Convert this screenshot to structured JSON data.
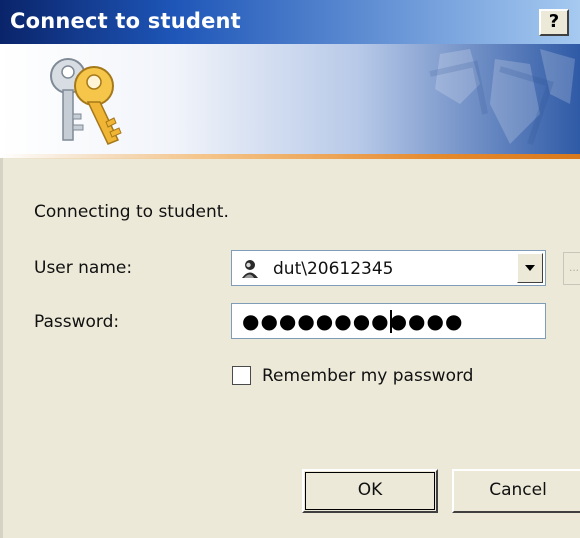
{
  "window": {
    "title": "Connect to student",
    "help_label": "?"
  },
  "banner": {
    "icon": "keys-icon"
  },
  "message": "Connecting to student.",
  "user_name": {
    "label": "User name:",
    "value": "dut\\20612345",
    "icon": "user-account-icon"
  },
  "password": {
    "label": "Password:",
    "masked_value": "●●●●●●●●●●●●"
  },
  "remember": {
    "label": "Remember my password",
    "checked": false
  },
  "buttons": {
    "ok": "OK",
    "cancel": "Cancel",
    "browse": "..."
  },
  "colors": {
    "titlebar_start": "#0a246a",
    "titlebar_end": "#a6caf0",
    "dialog_bg": "#ece9d8",
    "accent_stripe": "#e68a2e"
  }
}
